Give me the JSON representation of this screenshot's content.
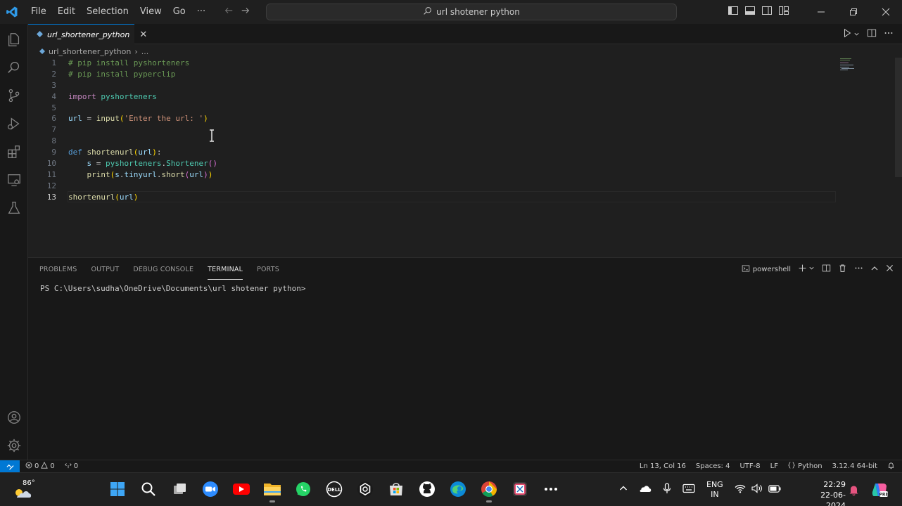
{
  "menu": {
    "items": [
      "File",
      "Edit",
      "Selection",
      "View",
      "Go"
    ],
    "more": "···"
  },
  "search": {
    "text": "url shotener python"
  },
  "tab": {
    "label": "url_shortener_python",
    "close": "✕"
  },
  "breadcrumb": {
    "file": "url_shortener_python",
    "sep": "›",
    "more": "..."
  },
  "editor": {
    "line_numbers": [
      "1",
      "2",
      "3",
      "4",
      "5",
      "6",
      "7",
      "8",
      "9",
      "10",
      "11",
      "12",
      "13"
    ],
    "current_line": 13
  },
  "panel": {
    "tabs": [
      "PROBLEMS",
      "OUTPUT",
      "DEBUG CONSOLE",
      "TERMINAL",
      "PORTS"
    ],
    "active_tab": "TERMINAL",
    "shell": "powershell",
    "terminal_line": "PS C:\\Users\\sudha\\OneDrive\\Documents\\url shotener python>"
  },
  "status": {
    "errors": "0",
    "warnings": "0",
    "ports": "0",
    "position": "Ln 13, Col 16",
    "spaces": "Spaces: 4",
    "encoding": "UTF-8",
    "eol": "LF",
    "language": "Python",
    "interpreter": "3.12.4 64-bit"
  },
  "taskbar": {
    "temperature": "86°",
    "lang_top": "ENG",
    "lang_bottom": "IN",
    "time": "22:29",
    "date": "22-06-2024"
  },
  "colors": {
    "accent": "#0078d4",
    "comment": "#6a9955",
    "keyword": "#c586c0",
    "string": "#ce9178",
    "function": "#dcdcaa"
  }
}
